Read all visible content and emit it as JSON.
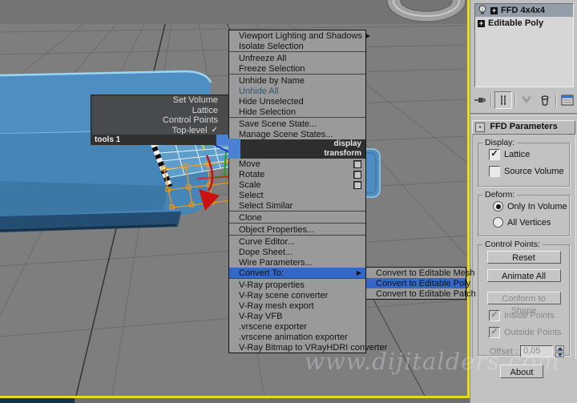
{
  "icons": {
    "submenu_arrow": "▶",
    "checkmark": "✓",
    "collapse": "-",
    "plus": "+"
  },
  "colors": {
    "highlight_blue": "#3468c6",
    "quad_center_blue": "#4b80d4",
    "active_viewport_yellow": "#e9da1c",
    "sofa_blue": "#4e8ec2",
    "lattice_orange": "#e8971f",
    "gizmo_red": "#cc1111"
  },
  "viewport": {
    "watermark": "www.dijitalders.com"
  },
  "quad_menu": {
    "tools_quad": {
      "title": "tools 1",
      "items": [
        {
          "label": "Set Volume"
        },
        {
          "label": "Lattice"
        },
        {
          "label": "Control Points"
        },
        {
          "label": "Top-level",
          "checked": true
        }
      ]
    },
    "display_quad": {
      "title": "display",
      "items": [
        {
          "label": "Viewport Lighting and Shadows",
          "submenu": true
        },
        {
          "label": "Isolate Selection"
        },
        {
          "label": "Unfreeze All"
        },
        {
          "label": "Freeze Selection"
        },
        {
          "label": "Unhide by Name"
        },
        {
          "label": "Unhide All",
          "disabled": true
        },
        {
          "label": "Hide Unselected"
        },
        {
          "label": "Hide Selection"
        },
        {
          "label": "Save Scene State..."
        },
        {
          "label": "Manage Scene States..."
        }
      ]
    },
    "transform_quad": {
      "title": "transform",
      "items": [
        {
          "label": "Move",
          "settings": true
        },
        {
          "label": "Rotate",
          "settings": true
        },
        {
          "label": "Scale",
          "settings": true
        },
        {
          "label": "Select"
        },
        {
          "label": "Select Similar"
        },
        {
          "label": "Clone"
        },
        {
          "label": "Object Properties..."
        },
        {
          "label": "Curve Editor..."
        },
        {
          "label": "Dope Sheet..."
        },
        {
          "label": "Wire Parameters..."
        },
        {
          "label": "Convert To:",
          "submenu": true,
          "highlighted": true
        },
        {
          "label": "V-Ray properties"
        },
        {
          "label": "V-Ray scene converter"
        },
        {
          "label": "V-Ray mesh export"
        },
        {
          "label": "V-Ray VFB"
        },
        {
          "label": ".vrscene exporter"
        },
        {
          "label": ".vrscene animation exporter"
        },
        {
          "label": "V-Ray Bitmap to VRayHDRI converter"
        }
      ]
    },
    "convert_submenu": {
      "items": [
        {
          "label": "Convert to Editable Mesh"
        },
        {
          "label": "Convert to Editable Poly",
          "highlighted": true
        },
        {
          "label": "Convert to Editable Patch"
        }
      ]
    }
  },
  "command_panel": {
    "modifier_stack": {
      "rows": [
        {
          "label": "FFD 4x4x4",
          "selected": true
        },
        {
          "label": "Editable Poly"
        }
      ]
    },
    "rollout": {
      "title": "FFD Parameters",
      "display_group": {
        "label": "Display:",
        "lattice": "Lattice",
        "source_volume": "Source Volume"
      },
      "deform_group": {
        "label": "Deform:",
        "only_in_volume": "Only In Volume",
        "all_vertices": "All Vertices"
      },
      "control_points_group": {
        "label": "Control Points:",
        "reset": "Reset",
        "animate_all": "Animate All",
        "conform": "Conform to Shape",
        "inside_points": "Inside Points",
        "outside_points": "Outside Points",
        "offset_label": "Offset :",
        "offset_value": "0,05"
      },
      "about": "About"
    }
  }
}
